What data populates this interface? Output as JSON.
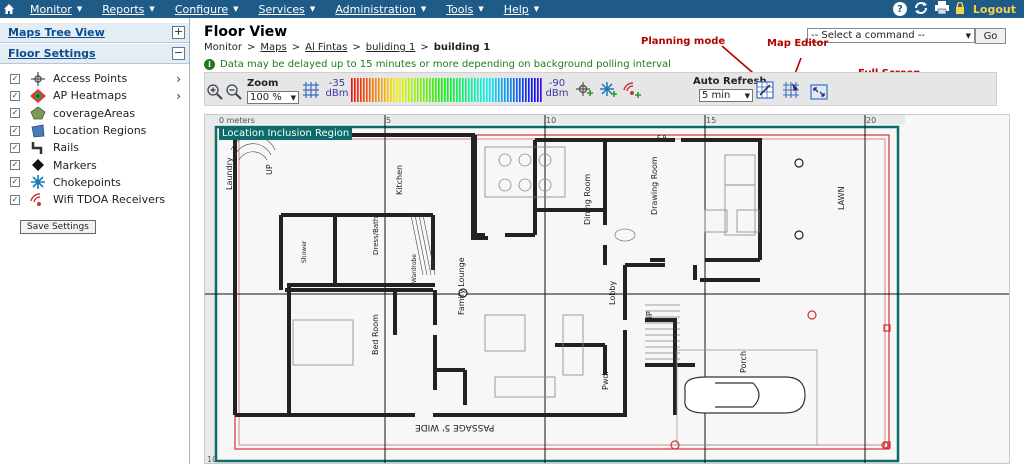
{
  "nav": {
    "menus": [
      {
        "label": "Monitor"
      },
      {
        "label": "Reports"
      },
      {
        "label": "Configure"
      },
      {
        "label": "Services"
      },
      {
        "label": "Administration"
      },
      {
        "label": "Tools"
      },
      {
        "label": "Help"
      }
    ],
    "logout": "Logout",
    "help_glyph": "?"
  },
  "left_panel": {
    "maps_tree": "Maps Tree View",
    "maps_tree_btn": "+",
    "floor_settings": "Floor Settings",
    "floor_settings_btn": "−",
    "layers": [
      {
        "label": "Access Points",
        "icon": "access-point-icon",
        "expandable": true
      },
      {
        "label": "AP Heatmaps",
        "icon": "heatmap-icon",
        "expandable": true
      },
      {
        "label": "coverageAreas",
        "icon": "coverage-area-icon",
        "expandable": false
      },
      {
        "label": "Location Regions",
        "icon": "location-region-icon",
        "expandable": false
      },
      {
        "label": "Rails",
        "icon": "rails-icon",
        "expandable": false
      },
      {
        "label": "Markers",
        "icon": "marker-icon",
        "expandable": false
      },
      {
        "label": "Chokepoints",
        "icon": "chokepoint-icon",
        "expandable": false
      },
      {
        "label": "Wifi TDOA Receivers",
        "icon": "wifi-tdoa-icon",
        "expandable": false
      }
    ],
    "save_settings": "Save Settings"
  },
  "main": {
    "title": "Floor View",
    "breadcrumb": {
      "items": [
        "Monitor",
        "Maps",
        "Al Fintas",
        "buliding 1",
        "building 1"
      ],
      "separator": ">"
    },
    "notice": "Data may be delayed up to 15 minutes or more depending on background polling interval",
    "command_select": "-- Select a command --",
    "go": "Go"
  },
  "annotations": {
    "planning_mode": "Planning mode",
    "map_editor": "Map Editor",
    "full_screen": "Full Screen"
  },
  "toolbar": {
    "zoom_label": "Zoom",
    "zoom_value": "100 %",
    "dbm_low_value": "-35",
    "dbm_high_value": "-90",
    "dbm_unit": "dBm",
    "auto_refresh_label": "Auto Refresh",
    "auto_refresh_value": "5 min"
  },
  "map": {
    "region_label": "Location Inclusion Region",
    "ruler_x": [
      "0 meters",
      "5",
      "10",
      "15",
      "20"
    ],
    "ruler_y_bottom": "10",
    "rooms": [
      "Laundry",
      "Kitchen",
      "Dress/Bath",
      "Wardrobe",
      "Dining Room",
      "Drawing Room",
      "LAWN",
      "Family Lounge",
      "Bed Room",
      "Lobby",
      "Porch",
      "Pwdr",
      "UP",
      "UP",
      "PASSAGE 5' WIDE",
      "F-P",
      "Shower"
    ]
  },
  "colors": {
    "nav_bg": "#1e5b86",
    "annotation_red": "#b30000",
    "region_teal": "#0d6b6b",
    "notice_green": "#1f7a1f"
  }
}
